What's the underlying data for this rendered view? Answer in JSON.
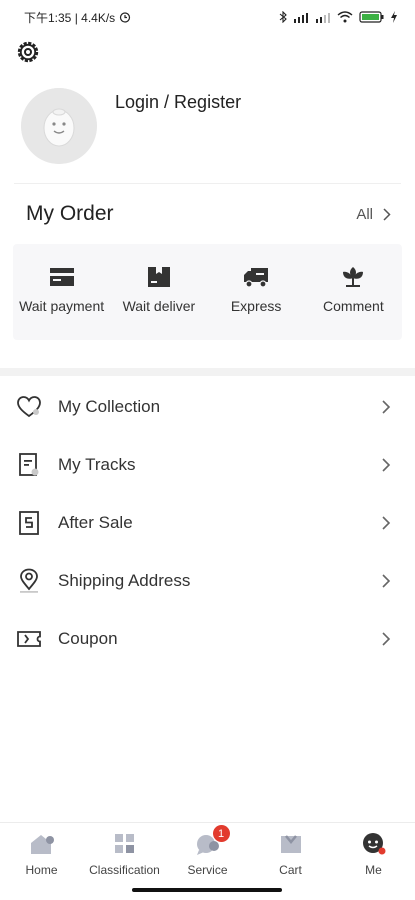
{
  "status_bar": {
    "time_speed": "下午1:35 | 4.4K/s",
    "alarm_icon": "alarm-icon",
    "bluetooth_icon": "bluetooth-icon",
    "signal_icon": "signal-icon",
    "wifi_icon": "wifi-icon",
    "battery_icon": "battery-icon",
    "battery_color": "#3cb043"
  },
  "header": {
    "settings_icon": "gear-icon"
  },
  "profile": {
    "login_label": "Login / Register"
  },
  "order": {
    "title": "My Order",
    "all_label": "All",
    "items": [
      {
        "label": "Wait payment",
        "icon": "wallet-icon"
      },
      {
        "label": "Wait deliver",
        "icon": "package-icon"
      },
      {
        "label": "Express",
        "icon": "truck-icon"
      },
      {
        "label": "Comment",
        "icon": "flower-icon"
      }
    ]
  },
  "menu": [
    {
      "label": "My Collection",
      "icon": "heart-icon"
    },
    {
      "label": "My Tracks",
      "icon": "document-icon"
    },
    {
      "label": "After Sale",
      "icon": "after-sale-icon"
    },
    {
      "label": "Shipping Address",
      "icon": "location-icon"
    },
    {
      "label": "Coupon",
      "icon": "ticket-icon"
    }
  ],
  "nav": [
    {
      "label": "Home",
      "icon": "home-icon"
    },
    {
      "label": "Classification",
      "icon": "grid-icon"
    },
    {
      "label": "Service",
      "icon": "chat-icon",
      "badge": "1"
    },
    {
      "label": "Cart",
      "icon": "cart-icon"
    },
    {
      "label": "Me",
      "icon": "profile-icon"
    }
  ],
  "colors": {
    "accent_red": "#e23b2e",
    "icon_dark": "#333333",
    "nav_icon_gray": "#b8bcc8"
  }
}
